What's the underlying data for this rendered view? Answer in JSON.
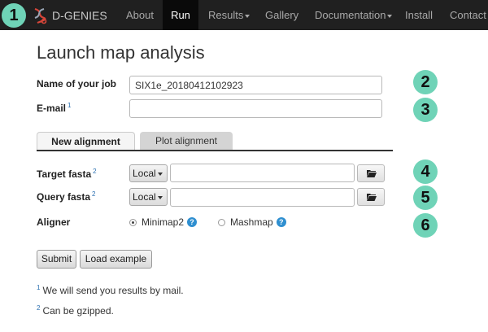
{
  "navbar": {
    "brand": "D-GENIES",
    "items": [
      {
        "label": "About"
      },
      {
        "label": "Run"
      },
      {
        "label": "Results"
      },
      {
        "label": "Gallery"
      },
      {
        "label": "Documentation"
      },
      {
        "label": "Install"
      },
      {
        "label": "Contact"
      }
    ]
  },
  "badges": [
    "1",
    "2",
    "3",
    "4",
    "5",
    "6"
  ],
  "page": {
    "title": "Launch map analysis"
  },
  "form": {
    "job_name_label": "Name of your job",
    "job_name_value": "SIX1e_20180412102923",
    "email_label": "E-mail",
    "email_footnote": "1",
    "email_value": "",
    "tabs": [
      {
        "label": "New alignment",
        "active": true
      },
      {
        "label": "Plot alignment",
        "active": false
      }
    ],
    "target_label": "Target fasta",
    "target_footnote": "2",
    "target_source": "Local",
    "target_value": "",
    "query_label": "Query fasta",
    "query_footnote": "2",
    "query_source": "Local",
    "query_value": "",
    "aligner_label": "Aligner",
    "aligners": [
      {
        "label": "Minimap2",
        "checked": true
      },
      {
        "label": "Mashmap",
        "checked": false
      }
    ],
    "help_glyph": "?",
    "submit_label": "Submit",
    "load_example_label": "Load example"
  },
  "notes": [
    {
      "mark": "1",
      "text": "We will send you results by mail."
    },
    {
      "mark": "2",
      "text": "Can be gzipped."
    }
  ],
  "colors": {
    "navbar_bg": "#202020",
    "badge": "#6fd3b7",
    "help_icon": "#2f8fd0",
    "footnote_mark": "#2a6fb0"
  }
}
